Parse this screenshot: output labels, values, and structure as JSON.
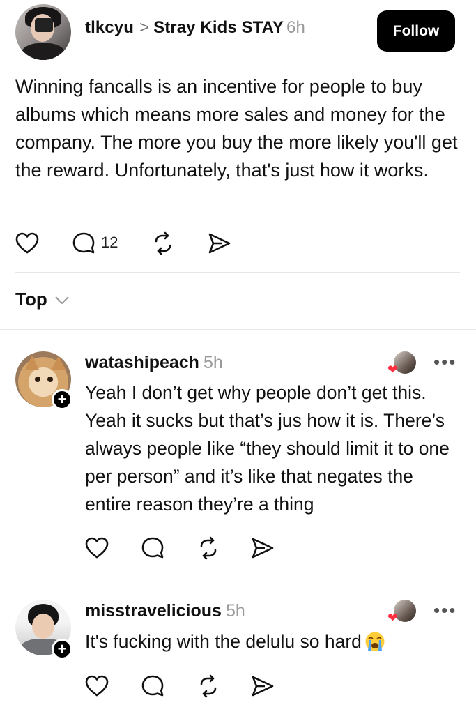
{
  "post": {
    "author": "tlkcyu",
    "community": "Stray Kids STAY",
    "time": "6h",
    "follow_label": "Follow",
    "text": "Winning fancalls is an incentive for people to buy albums which means more sales and money for the company. The more you buy the more likely you'll get the reward. Unfortunately, that's just how it works.",
    "reply_count": "12",
    "icons": [
      "heart-icon",
      "comment-icon",
      "repost-icon",
      "share-icon"
    ]
  },
  "sort": {
    "label": "Top"
  },
  "comments": [
    {
      "author": "watashipeach",
      "time": "5h",
      "text": "Yeah I don’t get why people don’t get this. Yeah it sucks but that’s jus how it is. There’s always people like “they should limit it to one per person” and it’s like that negates the entire reason they’re a thing"
    },
    {
      "author": "misstravelicious",
      "time": "5h",
      "text": "It's fucking with the delulu so hard",
      "emoji": "loudly-crying-face-emoji"
    }
  ],
  "colors": {
    "accent": "#000000",
    "muted": "#9a9a9a",
    "like": "#ff3040"
  }
}
